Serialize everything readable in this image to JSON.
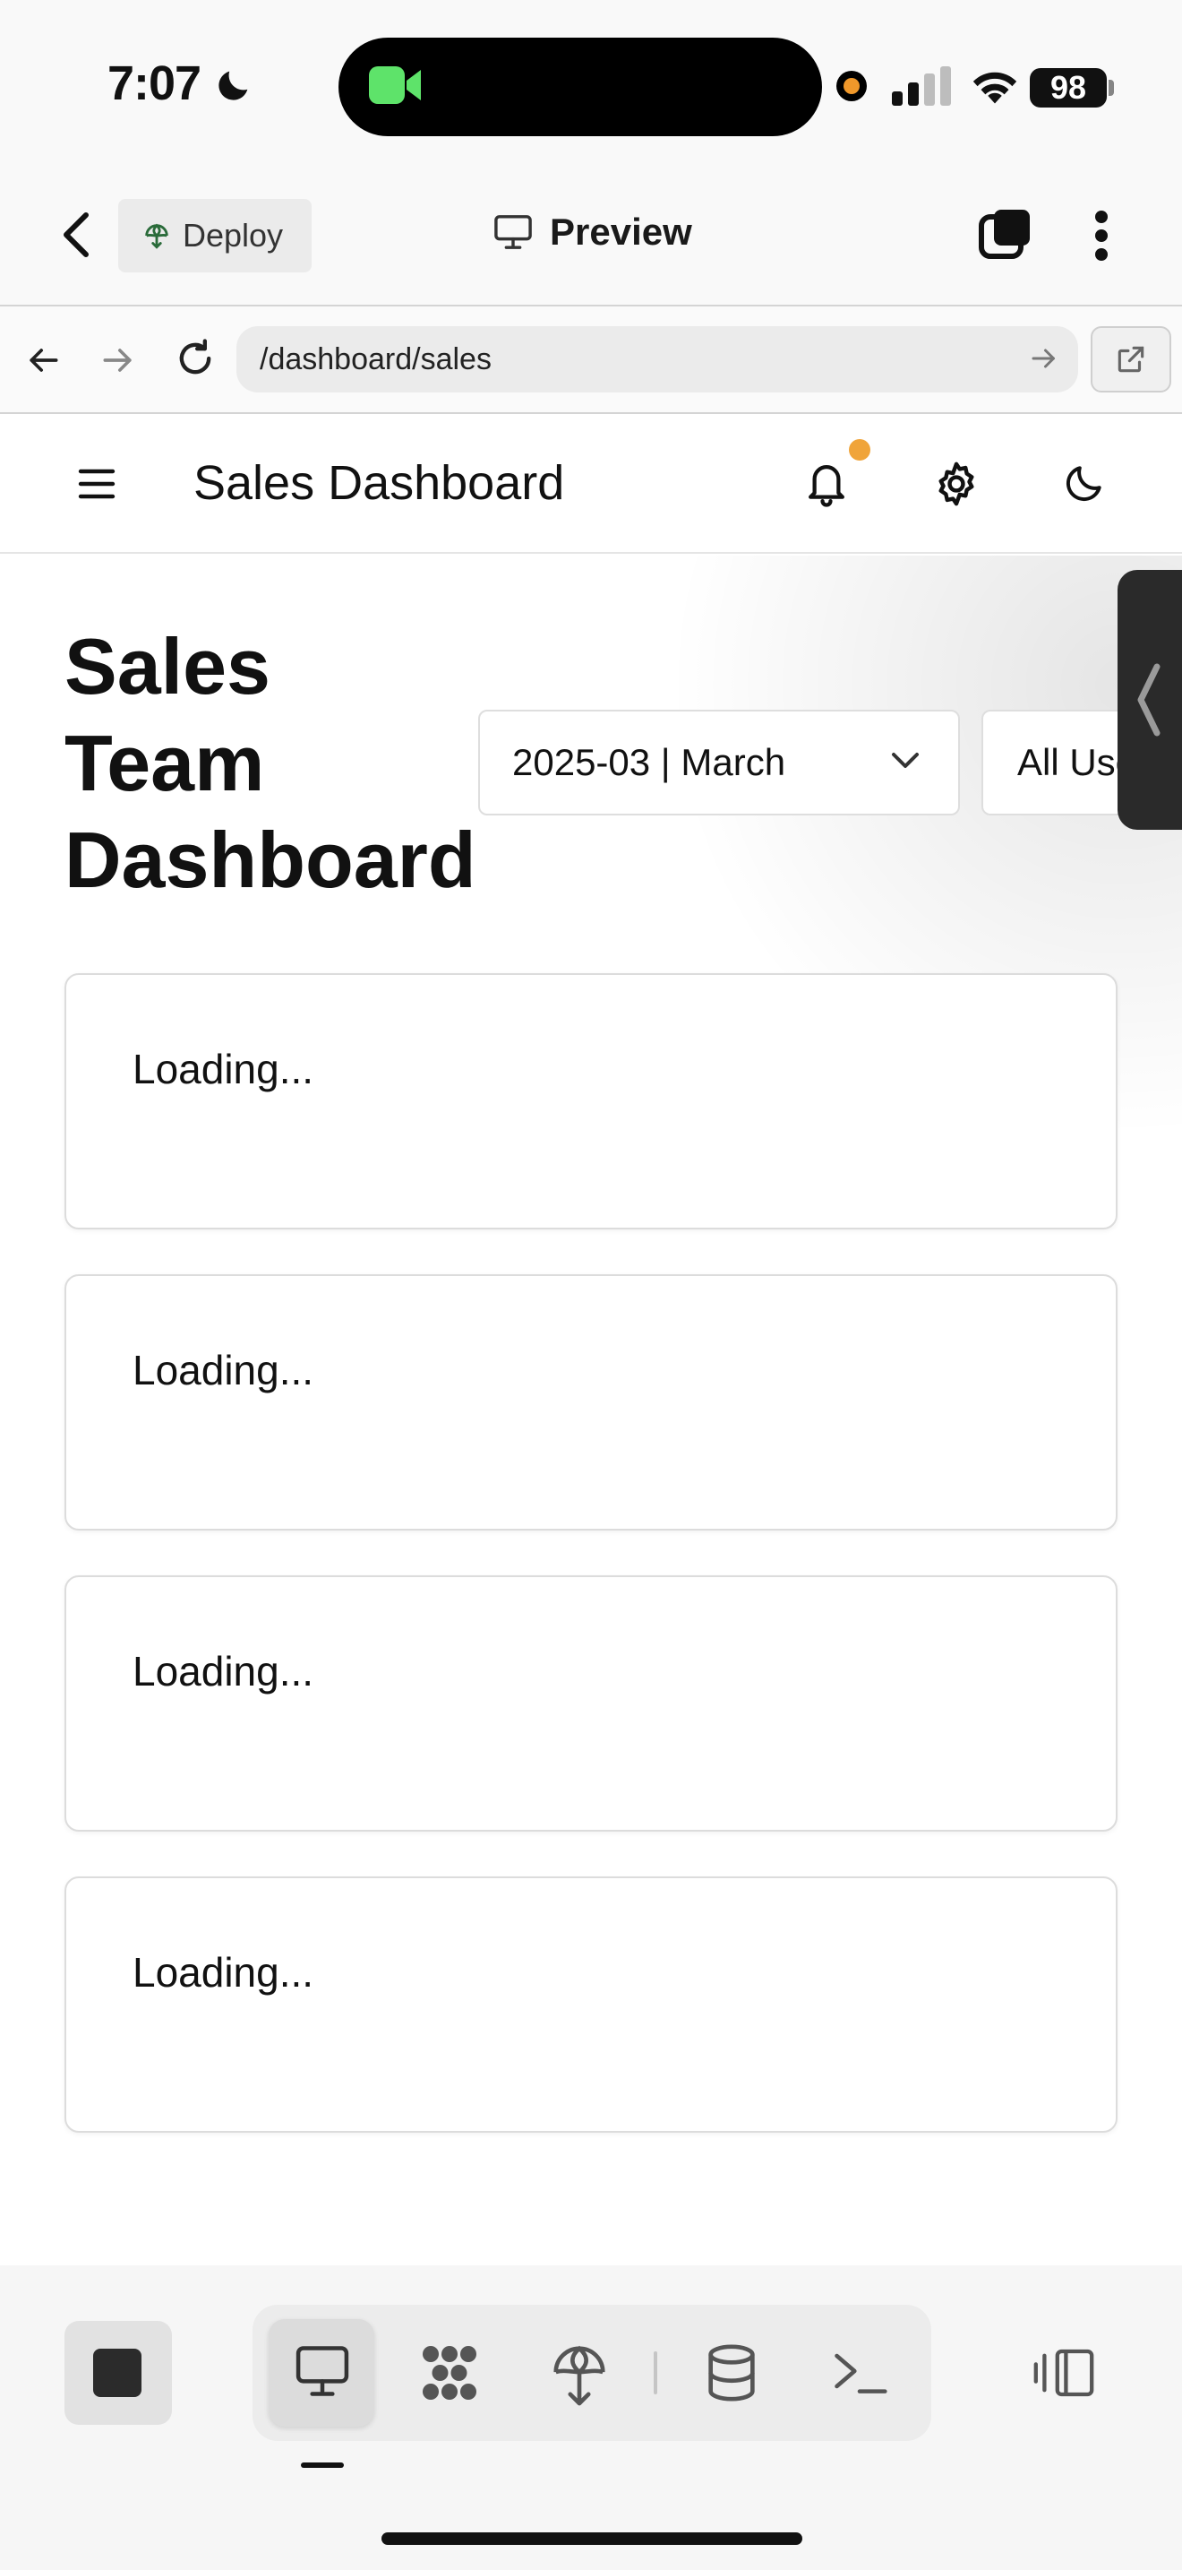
{
  "status_bar": {
    "time": "7:07",
    "battery": "98"
  },
  "app_header": {
    "deploy_label": "Deploy",
    "preview_label": "Preview"
  },
  "browser": {
    "url": "/dashboard/sales"
  },
  "app_nav": {
    "title": "Sales Dashboard",
    "has_notification": true,
    "notification_color": "#f0a43a"
  },
  "main": {
    "page_title": "Sales Team Dashboard",
    "month_filter": "2025-03 | March",
    "user_filter": "All Users",
    "cards": [
      {
        "text": "Loading..."
      },
      {
        "text": "Loading..."
      },
      {
        "text": "Loading..."
      },
      {
        "text": "Loading..."
      }
    ]
  },
  "toolbar": {
    "items": [
      {
        "icon": "monitor-icon",
        "active": true
      },
      {
        "icon": "workflow-icon",
        "active": false
      },
      {
        "icon": "deploy-icon",
        "active": false
      },
      {
        "icon": "database-icon",
        "active": false
      },
      {
        "icon": "terminal-icon",
        "active": false
      }
    ]
  }
}
